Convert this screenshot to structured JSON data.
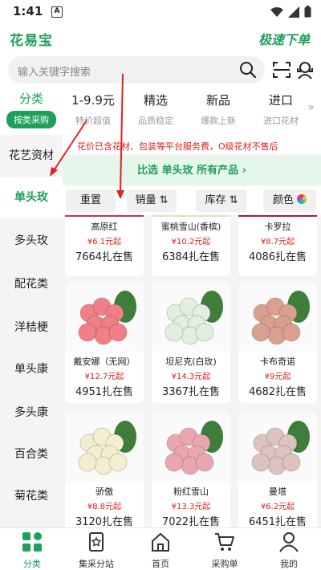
{
  "status": {
    "time": "1:41",
    "notif": "A"
  },
  "header": {
    "logo": "花易宝",
    "right_logo": "极速下单"
  },
  "search": {
    "placeholder": "输入关键字搜索"
  },
  "top_categories": {
    "first": {
      "title": "分类",
      "sub": "按类采购"
    },
    "items": [
      {
        "title": "1-9.9元",
        "sub": "特价超值"
      },
      {
        "title": "精选",
        "sub": "品质稳定"
      },
      {
        "title": "新品",
        "sub": "爆款上新"
      },
      {
        "title": "进口",
        "sub": "进口花材"
      }
    ],
    "more": "»"
  },
  "notice": "花价已含花材、包装等平台服务费，O级花材不售后",
  "compare": "比选 单头玫 所有产品 ›",
  "sidebar": {
    "items": [
      "花艺资材",
      "单头玫",
      "多头玫",
      "配花类",
      "洋桔梗",
      "单头康",
      "多头康",
      "百合类",
      "菊花类"
    ],
    "active_index": 1
  },
  "filters": {
    "reset": "重置",
    "sales": "销量 ⇅",
    "stock": "库存 ⇅",
    "color": "颜色"
  },
  "products": [
    {
      "name": "高原红",
      "price": "¥6.1元起",
      "stock": "7664扎在售",
      "color": "#c73449"
    },
    {
      "name": "蜜桃雪山(香槟)",
      "price": "¥10.2元起",
      "stock": "6384扎在售",
      "color": "#f2d9bf"
    },
    {
      "name": "卡罗拉",
      "price": "¥8.7元起",
      "stock": "4086扎在售",
      "color": "#b3192a"
    },
    {
      "name": "戴安娜（无网）",
      "price": "¥12.7元起",
      "stock": "4951扎在售",
      "color": "#f07f86"
    },
    {
      "name": "坦尼克(白玫)",
      "price": "¥14.3元起",
      "stock": "3367扎在售",
      "color": "#e3efde"
    },
    {
      "name": "卡布奇诺",
      "price": "¥9元起",
      "stock": "4682扎在售",
      "color": "#d9a090"
    },
    {
      "name": "骄傲",
      "price": "¥8.8元起",
      "stock": "3120扎在售",
      "color": "#f4eed0"
    },
    {
      "name": "粉红雪山",
      "price": "¥13.3元起",
      "stock": "7022扎在售",
      "color": "#e9a7ad"
    },
    {
      "name": "曼塔",
      "price": "¥6.2元起",
      "stock": "6451扎在售",
      "color": "#dcc3c0"
    }
  ],
  "tabbar": [
    {
      "label": "分类",
      "icon": "grid-icon"
    },
    {
      "label": "集采分站",
      "icon": "collection-icon"
    },
    {
      "label": "首页",
      "icon": "home-icon"
    },
    {
      "label": "采购单",
      "icon": "cart-icon"
    },
    {
      "label": "我的",
      "icon": "user-icon"
    }
  ],
  "colors": {
    "brand": "#1ea05a",
    "price": "#e0201b",
    "annotation": "#e0201b"
  }
}
